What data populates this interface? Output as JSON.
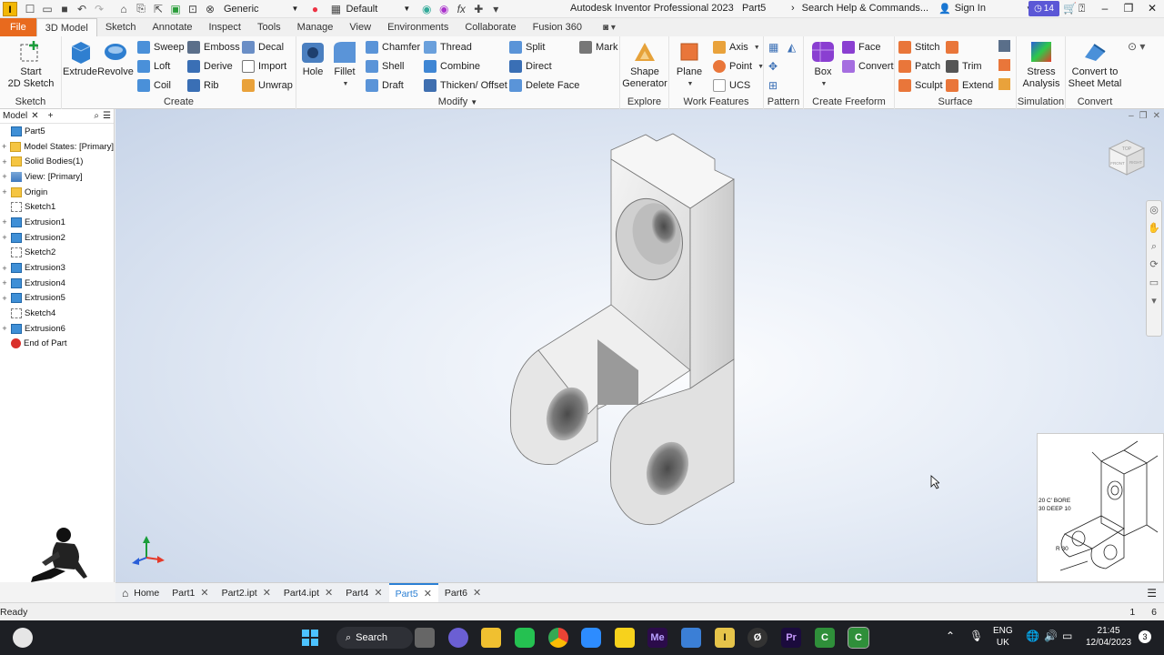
{
  "titlebar": {
    "app_logo": "I",
    "appearance": "Generic",
    "style": "Default",
    "fx": "fx",
    "title": "Autodesk Inventor Professional 2023",
    "doc": "Part5",
    "search_placeholder": "Search Help & Commands...",
    "sign_in": "Sign In",
    "notif_count": "14"
  },
  "tabs": [
    "File",
    "3D Model",
    "Sketch",
    "Annotate",
    "Inspect",
    "Tools",
    "Manage",
    "View",
    "Environments",
    "Collaborate",
    "Fusion 360"
  ],
  "ribbon": {
    "sketch": {
      "start_sketch_l1": "Start",
      "start_sketch_l2": "2D Sketch",
      "label": "Sketch"
    },
    "create": {
      "extrude": "Extrude",
      "revolve": "Revolve",
      "sweep": "Sweep",
      "loft": "Loft",
      "coil": "Coil",
      "emboss": "Emboss",
      "derive": "Derive",
      "rib": "Rib",
      "decal": "Decal",
      "import": "Import",
      "unwrap": "Unwrap",
      "label": "Create"
    },
    "modify": {
      "hole": "Hole",
      "fillet": "Fillet",
      "chamfer": "Chamfer",
      "shell": "Shell",
      "draft": "Draft",
      "thread": "Thread",
      "combine": "Combine",
      "thicken": "Thicken/ Offset",
      "split": "Split",
      "direct": "Direct",
      "delete_face": "Delete Face",
      "mark": "Mark",
      "label": "Modify"
    },
    "explore": {
      "shape_gen_l1": "Shape",
      "shape_gen_l2": "Generator",
      "label": "Explore"
    },
    "work": {
      "plane": "Plane",
      "axis": "Axis",
      "point": "Point",
      "ucs": "UCS",
      "label": "Work Features"
    },
    "pattern": {
      "label": "Pattern"
    },
    "freeform": {
      "box": "Box",
      "face": "Face",
      "convert": "Convert",
      "label": "Create Freeform"
    },
    "surface": {
      "stitch": "Stitch",
      "patch": "Patch",
      "sculpt": "Sculpt",
      "trim": "Trim",
      "extend": "Extend",
      "label": "Surface"
    },
    "simulation": {
      "stress_l1": "Stress",
      "stress_l2": "Analysis",
      "label": "Simulation"
    },
    "convert": {
      "sheet_l1": "Convert to",
      "sheet_l2": "Sheet Metal",
      "label": "Convert"
    }
  },
  "browser": {
    "title": "Model",
    "items": [
      {
        "label": "Part5",
        "icon": "part",
        "expand": ""
      },
      {
        "label": "Model States: [Primary]",
        "icon": "folder",
        "expand": "+"
      },
      {
        "label": "Solid Bodies(1)",
        "icon": "folder",
        "expand": "+"
      },
      {
        "label": "View: [Primary]",
        "icon": "view",
        "expand": "+"
      },
      {
        "label": "Origin",
        "icon": "origin",
        "expand": "+"
      },
      {
        "label": "Sketch1",
        "icon": "sketch",
        "expand": ""
      },
      {
        "label": "Extrusion1",
        "icon": "solid",
        "expand": "+"
      },
      {
        "label": "Extrusion2",
        "icon": "solid",
        "expand": "+"
      },
      {
        "label": "Sketch2",
        "icon": "sketch",
        "expand": ""
      },
      {
        "label": "Extrusion3",
        "icon": "solid",
        "expand": "+"
      },
      {
        "label": "Extrusion4",
        "icon": "solid",
        "expand": "+"
      },
      {
        "label": "Extrusion5",
        "icon": "solid",
        "expand": "+"
      },
      {
        "label": "Sketch4",
        "icon": "sketch",
        "expand": ""
      },
      {
        "label": "Extrusion6",
        "icon": "solid",
        "expand": "+"
      },
      {
        "label": "End of Part",
        "icon": "end",
        "expand": ""
      }
    ]
  },
  "viewcube": {
    "top": "TOP",
    "front": "FRONT",
    "right": "RIGHT"
  },
  "reference": {
    "bore_l1": "20 C' BORE",
    "bore_l2": "30 DEEP 10",
    "radius": "R 30"
  },
  "doc_tabs": {
    "home": "Home",
    "items": [
      {
        "label": "Part1",
        "active": false
      },
      {
        "label": "Part2.ipt",
        "active": false
      },
      {
        "label": "Part4.ipt",
        "active": false
      },
      {
        "label": "Part4",
        "active": false
      },
      {
        "label": "Part5",
        "active": true
      },
      {
        "label": "Part6",
        "active": false
      }
    ]
  },
  "status": {
    "text": "Ready",
    "n1": "1",
    "n2": "6"
  },
  "taskbar": {
    "search": "Search",
    "lang_l1": "ENG",
    "lang_l2": "UK",
    "time": "21:45",
    "date": "12/04/2023",
    "badge": "3"
  },
  "colors": {
    "file_tab": "#e86a1e",
    "accent": "#2a7fd4",
    "notif": "#5b57d6"
  }
}
